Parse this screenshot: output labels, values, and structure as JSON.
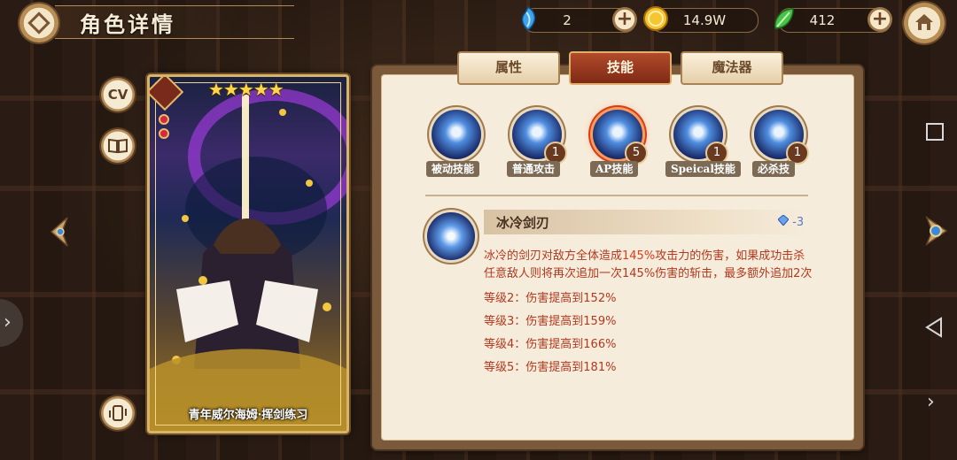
{
  "header": {
    "title": "角色详情",
    "resources": [
      {
        "name": "crystal",
        "icon": "blue-crystal-icon",
        "value": "2"
      },
      {
        "name": "gold",
        "icon": "gold-coin-icon",
        "value": "14.9W"
      },
      {
        "name": "leaf",
        "icon": "green-leaf-icon",
        "value": "412"
      }
    ],
    "plus": "+"
  },
  "sidebar": {
    "cv_label": "CV"
  },
  "card": {
    "stars": "★★★★★",
    "name": "青年威尔海姆·挥剑练习"
  },
  "tabs": [
    {
      "label": "属性",
      "active": false
    },
    {
      "label": "技能",
      "active": true
    },
    {
      "label": "魔法器",
      "active": false
    }
  ],
  "skills": [
    {
      "label": "被动技能",
      "level": ""
    },
    {
      "label": "普通攻击",
      "level": "1"
    },
    {
      "label": "AP技能",
      "level": "5"
    },
    {
      "label": "Speical技能",
      "level": "1"
    },
    {
      "label": "必杀技",
      "level": "1"
    }
  ],
  "detail": {
    "name": "冰冷剑刃",
    "cost": "-3",
    "desc_a": "冰冷的剑刃对敌方全体造成",
    "desc_pct": "145%",
    "desc_b": "攻击力的伤害，如果成功击杀任意敌人则将再次追加一次145%伤害的斩击，最多额外追加2次",
    "levels": [
      "等级2：伤害提高到152%",
      "等级3：伤害提高到159%",
      "等级4：伤害提高到166%",
      "等级5：伤害提高到181%"
    ]
  },
  "colors": {
    "accent": "#7e2a16",
    "panel_bg": "#f6ecdb",
    "desc_text": "#b2381e"
  }
}
